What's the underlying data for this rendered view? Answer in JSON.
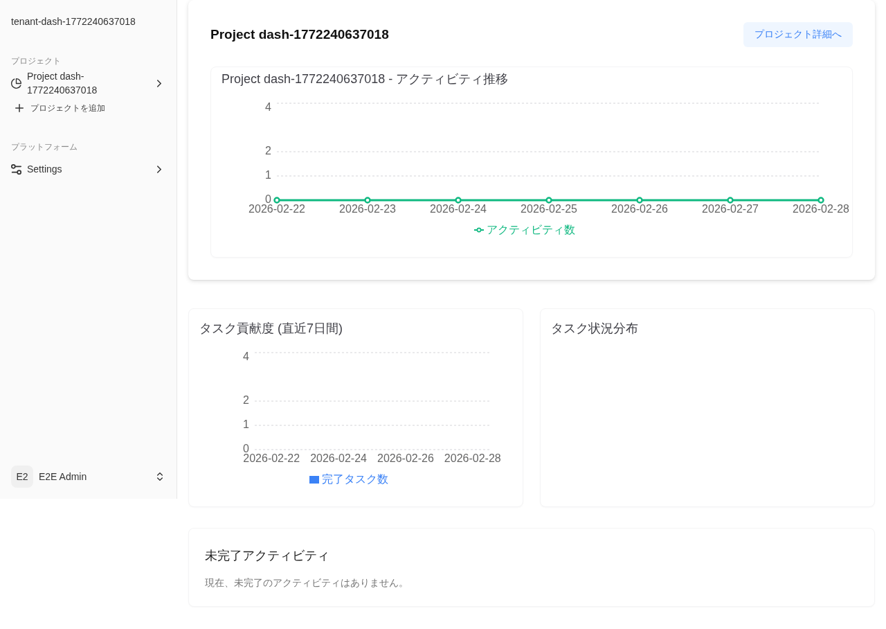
{
  "sidebar": {
    "workspace": "tenant-dash-1772240637018",
    "groups": [
      {
        "label": "プロジェクト",
        "items": [
          {
            "kind": "project",
            "label": "Project dash-1772240637018"
          },
          {
            "kind": "add",
            "label": "プロジェクトを追加"
          }
        ]
      },
      {
        "label": "プラットフォーム",
        "items": [
          {
            "kind": "settings",
            "label": "Settings"
          }
        ]
      }
    ],
    "user": {
      "initials": "E2",
      "name": "E2E Admin"
    }
  },
  "project_card": {
    "title": "Project dash-1772240637018",
    "button": "プロジェクト詳細へ",
    "activity_chart": {
      "chart_data": {
        "type": "line",
        "title": "Project dash-1772240637018 - アクティビティ推移",
        "categories": [
          "2026-02-22",
          "2026-02-23",
          "2026-02-24",
          "2026-02-25",
          "2026-02-26",
          "2026-02-27",
          "2026-02-28"
        ],
        "series": [
          {
            "name": "アクティビティ数",
            "color": "#10b981",
            "marker": "circle",
            "values": [
              0,
              0,
              0,
              0,
              0,
              0,
              0
            ]
          }
        ],
        "ylim": [
          0,
          4
        ],
        "yticks": [
          0,
          1,
          2,
          4
        ]
      }
    }
  },
  "task_contribution": {
    "chart_data": {
      "type": "bar",
      "title": "タスク貢献度 (直近7日間)",
      "categories": [
        "2026-02-22",
        "2026-02-24",
        "2026-02-26",
        "2026-02-28"
      ],
      "series": [
        {
          "name": "完了タスク数",
          "color": "#3b82f6",
          "values": [
            0,
            0,
            0,
            0
          ]
        }
      ],
      "ylim": [
        0,
        4
      ],
      "yticks": [
        0,
        1,
        2,
        4
      ]
    }
  },
  "task_status": {
    "title": "タスク状況分布"
  },
  "open_activities": {
    "title": "未完了アクティビティ",
    "empty_message": "現在、未完了のアクティビティはありません。"
  }
}
